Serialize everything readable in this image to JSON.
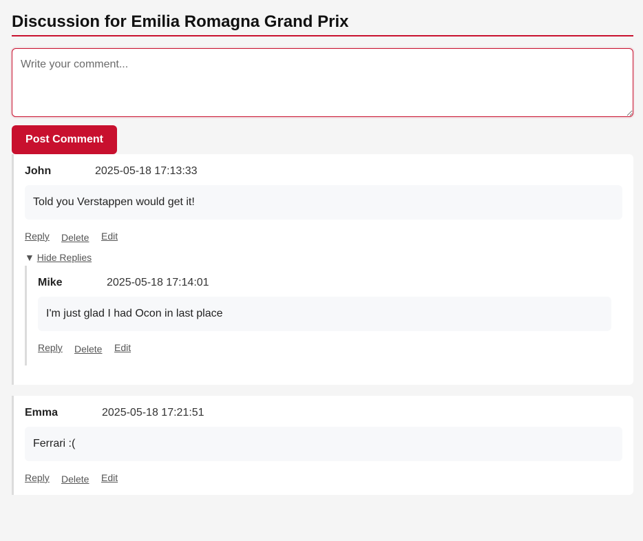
{
  "page": {
    "title": "Discussion for Emilia Romagna Grand Prix"
  },
  "composer": {
    "placeholder": "Write your comment...",
    "post_label": "Post Comment"
  },
  "actions": {
    "reply": "Reply",
    "delete": "Delete",
    "edit": "Edit"
  },
  "comments": [
    {
      "author": "John",
      "timestamp": "2025-05-18 17:13:33",
      "text": "Told you Verstappen would get it!",
      "toggle_icon": "▼",
      "toggle_label": "Hide Replies",
      "replies": [
        {
          "author": "Mike",
          "timestamp": "2025-05-18 17:14:01",
          "text": "I'm just glad I had Ocon in last place"
        }
      ]
    },
    {
      "author": "Emma",
      "timestamp": "2025-05-18 17:21:51",
      "text": "Ferrari :("
    }
  ],
  "colors": {
    "accent": "#c8102e",
    "background": "#f5f5f5",
    "card": "#ffffff",
    "bubble": "#f7f8fa"
  }
}
